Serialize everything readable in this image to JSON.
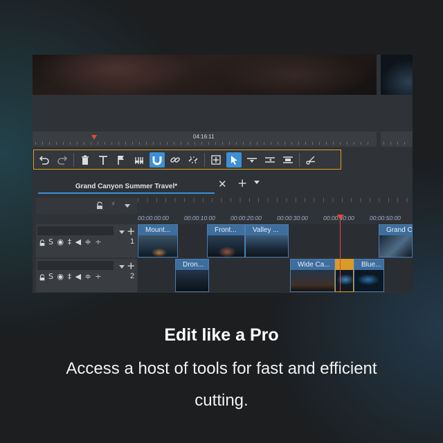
{
  "editor": {
    "ruler_time": "04:16:11",
    "project_tab": {
      "label": "Grand Canyon Summer Travel*",
      "close": "✕",
      "add": "+"
    },
    "toolbar_tools": [
      "undo",
      "redo",
      "delete",
      "text",
      "marker",
      "split",
      "magnet",
      "link",
      "unlink",
      "insert",
      "select",
      "trim",
      "ripple",
      "slip",
      "cut"
    ],
    "active_tools": [
      "magnet",
      "select"
    ],
    "timecodes": [
      "00:00:00:00",
      "00:00:10:00",
      "00:00:20:00",
      "00:00:30:00",
      "00:00:40:00",
      "00:00:50:00"
    ],
    "tracks": [
      {
        "number": "1",
        "add": "+",
        "controls": "S ◉ ‡ ◀ ≑ ÷",
        "clips": [
          {
            "title": "Mount..."
          },
          {
            "title": "Front..."
          },
          {
            "title": "Valley ..."
          },
          {
            "title": "Grand C"
          }
        ]
      },
      {
        "number": "2",
        "add": "+",
        "controls": "S ◉ ‡ ◀ ≑ ÷",
        "clips": [
          {
            "title": "Dron..."
          },
          {
            "title": "Wide Ca..."
          },
          {
            "title": ""
          },
          {
            "title": "Blue..."
          }
        ]
      }
    ],
    "colors": {
      "accent": "#3d8fd6",
      "toolbar_border": "#e0a020",
      "playhead": "#e04a3a",
      "clip_header": "#3e6e9e",
      "selected_clip": "#d89b2a"
    }
  },
  "caption": {
    "title": "Edit like a Pro",
    "subtitle": "Access a host of tools for fast and efficient cutting."
  }
}
